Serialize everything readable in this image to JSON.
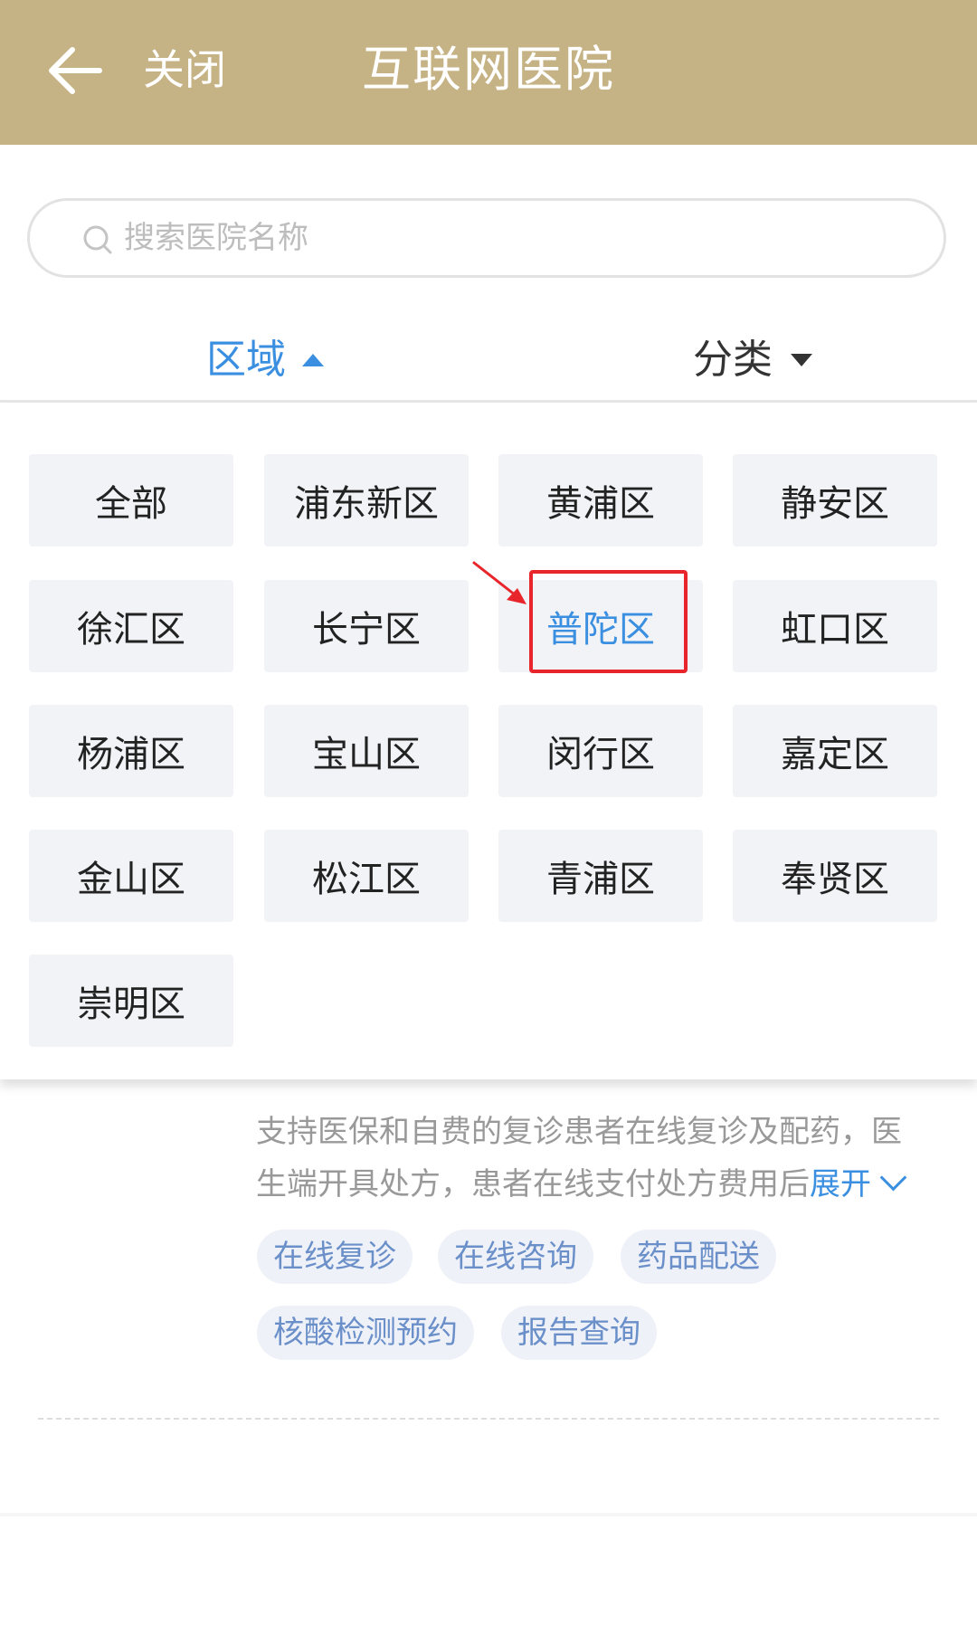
{
  "header": {
    "back_icon": "arrow-left-icon",
    "close_label": "关闭",
    "title": "互联网医院"
  },
  "search": {
    "icon": "search-icon",
    "placeholder": "搜索医院名称"
  },
  "filters": {
    "region_label": "区域",
    "category_label": "分类",
    "active": "区域"
  },
  "districts": {
    "items": [
      "全部",
      "浦东新区",
      "黄浦区",
      "静安区",
      "徐汇区",
      "长宁区",
      "普陀区",
      "虹口区",
      "杨浦区",
      "宝山区",
      "闵行区",
      "嘉定区",
      "金山区",
      "松江区",
      "青浦区",
      "奉贤区",
      "崇明区"
    ],
    "selected": "普陀区"
  },
  "hospital_card": {
    "description_line1": "支持医保和自费的复诊患者在线复诊及配药，医",
    "description_line2": "生端开具处方，患者在线支付处方费用后",
    "expand_label": "展开",
    "tags": [
      "在线复诊",
      "在线咨询",
      "药品配送",
      "核酸检测预约",
      "报告查询"
    ]
  },
  "colors": {
    "header_bg": "#c6b385",
    "accent_blue": "#3b8fe0",
    "district_bg": "#f2f3f7",
    "highlight_red": "#e8252a",
    "tag_text": "#6a8fc9"
  }
}
